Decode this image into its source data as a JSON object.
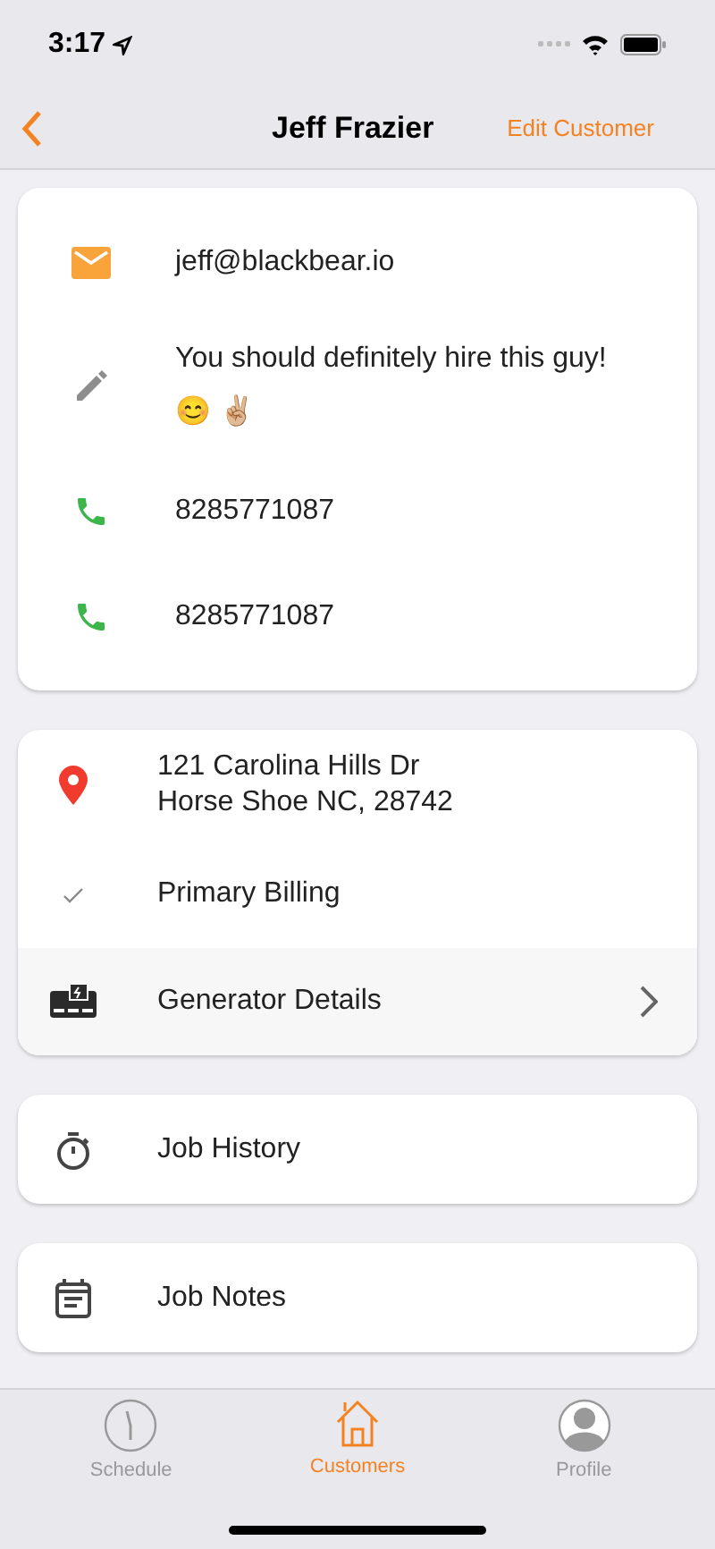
{
  "status_bar": {
    "time": "3:17"
  },
  "nav": {
    "title": "Jeff Frazier",
    "action": "Edit Customer"
  },
  "contact_card": [
    {
      "kind": "email",
      "text": "jeff@blackbear.io"
    },
    {
      "kind": "note",
      "text": "You should definitely hire this guy! 😊 ✌🏼"
    },
    {
      "kind": "phone",
      "text": "8285771087"
    },
    {
      "kind": "phone",
      "text": "8285771087"
    }
  ],
  "location_card": [
    {
      "kind": "address",
      "lines": [
        "121 Carolina Hills Dr",
        "Horse Shoe NC, 28742"
      ],
      "chevron": false
    },
    {
      "kind": "check",
      "lines": [
        "Primary Billing"
      ],
      "chevron": false
    },
    {
      "kind": "generator",
      "lines": [
        "Generator Details"
      ],
      "chevron": true
    }
  ],
  "links": [
    {
      "kind": "timer",
      "label": "Job History"
    },
    {
      "kind": "notes",
      "label": "Job Notes"
    }
  ],
  "tab_bar": [
    {
      "kind": "clock",
      "label": "Schedule",
      "selected": false
    },
    {
      "kind": "house",
      "label": "Customers",
      "selected": true
    },
    {
      "kind": "person",
      "label": "Profile",
      "selected": false
    }
  ]
}
